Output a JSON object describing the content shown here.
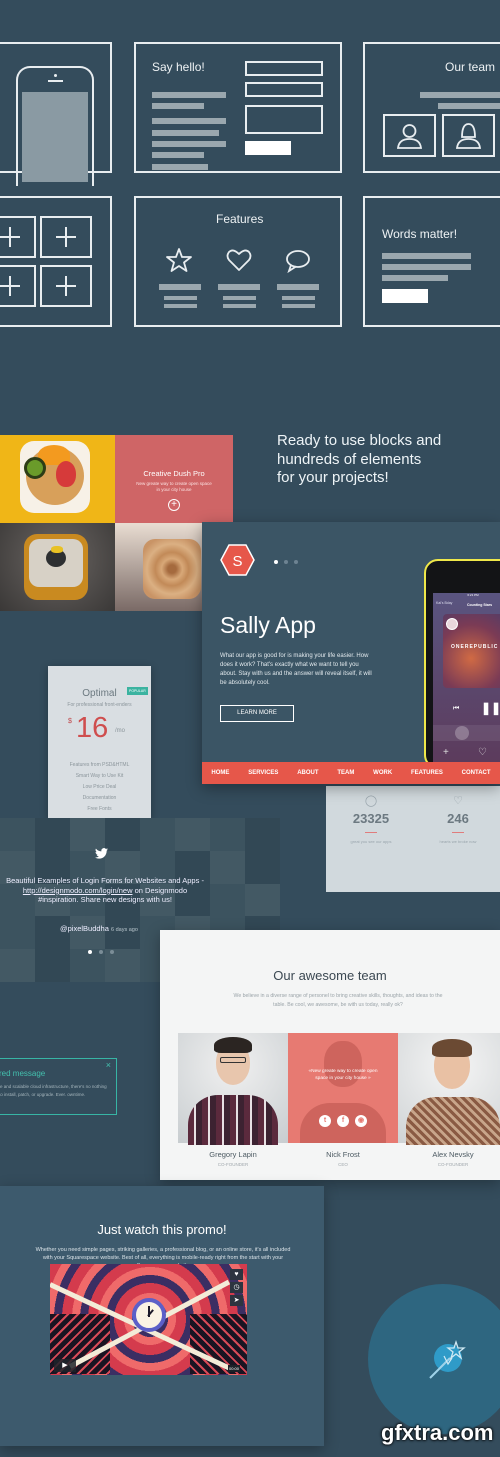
{
  "wireframes": {
    "say_hello": {
      "title": "Say hello!"
    },
    "our_team": {
      "title": "Our team"
    },
    "features": {
      "title": "Features",
      "icons": [
        "star-icon",
        "heart-icon",
        "speech-bubble-icon"
      ]
    },
    "words_matter": {
      "title": "Words matter!"
    }
  },
  "tagline": {
    "line1": "Ready to use blocks and",
    "line2": "hundreds of elements",
    "line3": "for your projects!"
  },
  "portfolio_tile": {
    "title": "Creative Dush Pro",
    "subtitle": "New greate way to create open space in your city house"
  },
  "sally": {
    "logo_letter": "S",
    "title": "Sally App",
    "description": "What our app is good for is making your life easier. How does it work? That's exactly what we want to tell you about. Stay with us and the answer will reveal itself, it will be absolutely cool.",
    "cta": "LEARN MORE",
    "slide_dots": 3,
    "active_dot": 1,
    "nav": [
      "HOME",
      "SERVICES",
      "ABOUT",
      "TEAM",
      "WORK",
      "FEATURES",
      "CONTACT"
    ],
    "phone": {
      "back_label": "Kal's Bday",
      "artist": "One Republic",
      "track": "Counting Stars",
      "album_text": "ONEREPUBLIC",
      "time": "6:21 PM"
    },
    "accent": "#e6574a"
  },
  "pricing": {
    "plan": "Optimal",
    "badge": "POPULAR",
    "subtitle": "For professional front-enders",
    "currency": "$",
    "price": "16",
    "period": "/mo",
    "features": [
      "Features from PSD&HTML",
      "Smart Way to Use Kit",
      "Low Price Deal",
      "Documentation",
      "Free Fonts"
    ]
  },
  "stats": [
    {
      "icon": "user-icon",
      "value": "23325",
      "label": "great you see our apps"
    },
    {
      "icon": "heart-icon",
      "value": "246",
      "label": "hearts we broke now"
    }
  ],
  "tweet": {
    "text_line1": "Beautiful Examples of Login Forms for Websites and Apps -",
    "link": "http://designmodo.com/login/new",
    "text_line2_rest": " on Designmodo",
    "text_line3": "#inspiration. Share new designs with us!",
    "handle": "@pixelBuddha",
    "time": "6 days ago"
  },
  "team": {
    "title": "Our awesome team",
    "description": "We believe in a diverse range of personel to bring creative skills, thoughts, and ideas to the table. Be cool, we awesome, be with us today, really ok?",
    "hover_quote": "«New greate way to create open space in your city house »",
    "members": [
      {
        "name": "Gregory Lapin",
        "role": "CO-FOUNDER"
      },
      {
        "name": "Nick Frost",
        "role": "CEO"
      },
      {
        "name": "Alex Nevsky",
        "role": "CO-FOUNDER"
      }
    ]
  },
  "alert": {
    "title": "red message",
    "body": "le and scalable cloud infrastructure, there's no nothing to install, patch, or upgrade. Ever. owntime.",
    "close": "×"
  },
  "promo": {
    "title": "Just watch this promo!",
    "description": "Whether you need simple pages, striking galleries, a professional blog, or an online store, it's all included with your Squarespace website. Best of all, everything is mobile-ready right from the start  with your Squarespace website",
    "video_time": "00:00"
  },
  "watermark": "gfxtra.com"
}
